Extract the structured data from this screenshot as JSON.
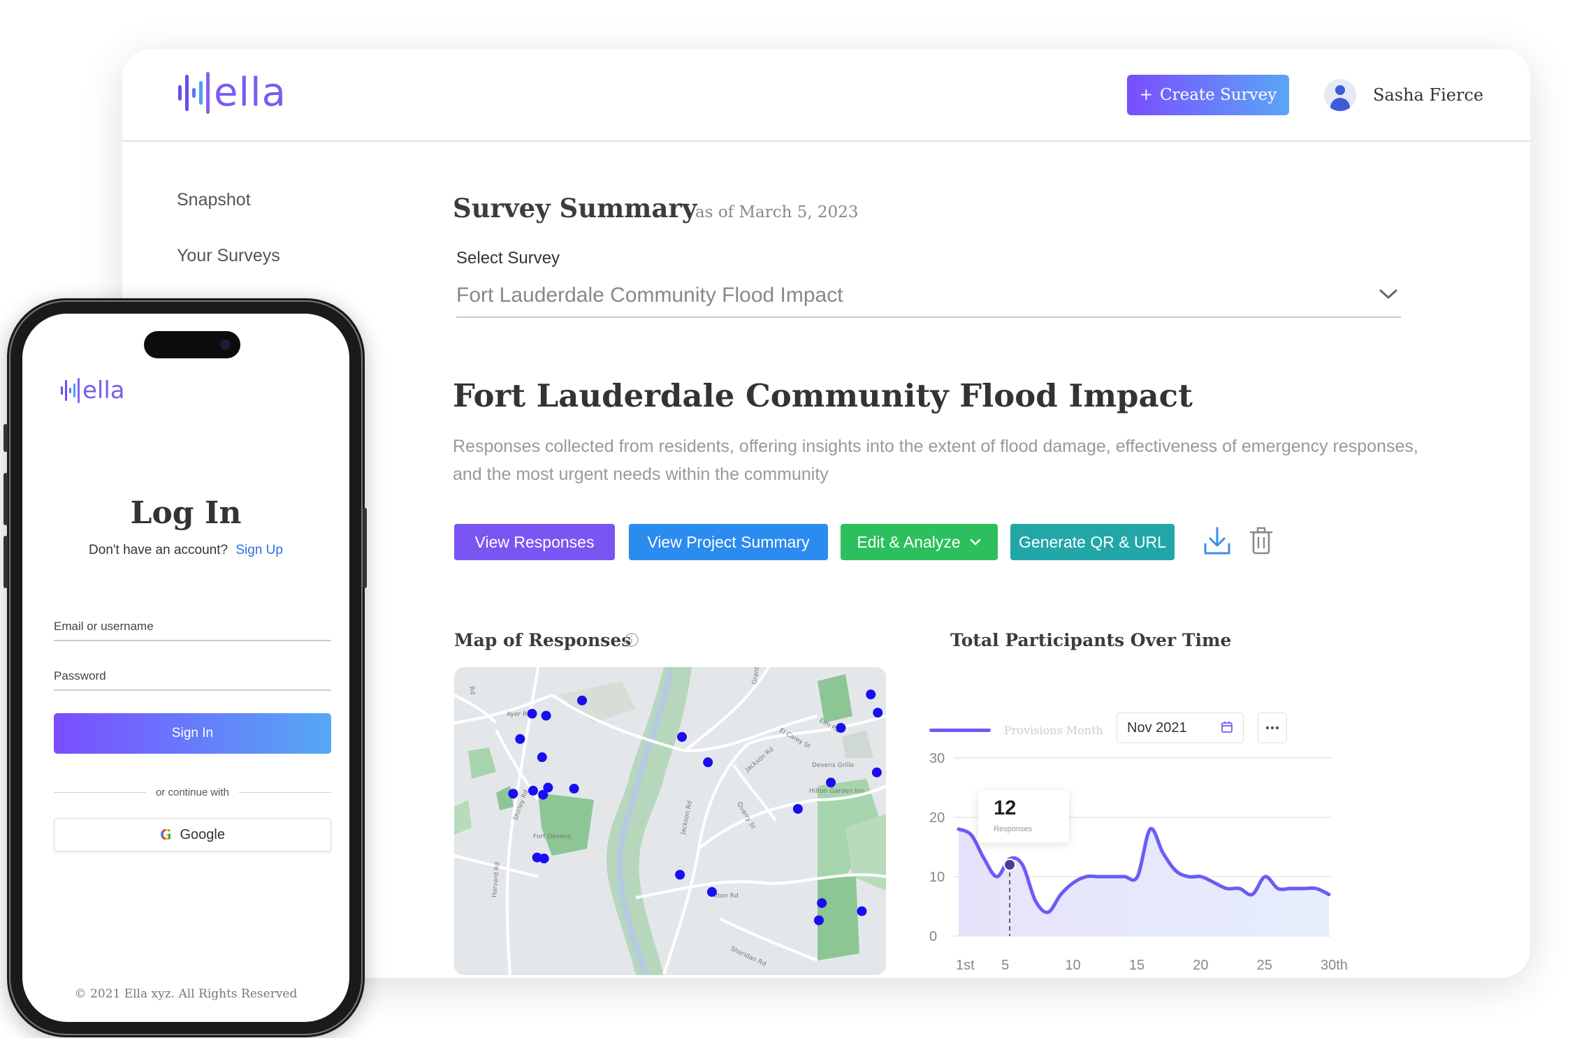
{
  "brand": {
    "logo_text": "ella"
  },
  "header": {
    "create_button_icon": "+",
    "create_button_label": "Create Survey",
    "user_name": "Sasha Fierce"
  },
  "sidebar": {
    "items": [
      {
        "label": "Snapshot"
      },
      {
        "label": "Your Surveys"
      }
    ]
  },
  "summary": {
    "title": "Survey Summary",
    "as_of": "as of March 5, 2023",
    "select_label": "Select Survey",
    "select_value": "Fort Lauderdale Community Flood Impact"
  },
  "project": {
    "title": "Fort Lauderdale Community Flood Impact",
    "description": "Responses collected from residents, offering insights into the extent of flood damage, effectiveness of emergency responses, and the most urgent needs within the community"
  },
  "actions": {
    "view_responses": "View Responses",
    "view_project_summary": "View Project Summary",
    "edit_analyze": "Edit & Analyze",
    "generate_qr": "Generate QR & URL",
    "download_icon": "download-icon",
    "delete_icon": "trash-icon"
  },
  "map": {
    "title": "Map of Responses",
    "info_icon": "info-icon",
    "labels": {
      "ayer_rd": "Ayer Rd",
      "fort_devens": "Fort Devens",
      "harvard_rd": "Harvard Rd",
      "jackson_rd": "Jackson Rd",
      "devens_grille": "Devens Grille",
      "hilton_garden_inn": "Hilton Garden Inn",
      "elm_rd": "Elm Rd",
      "el_carey_st": "El Carey St",
      "jackson_rd_2": "Jackson Rd",
      "hilton_rd": "ilton Rd",
      "quarry_st": "Quarry St",
      "grant_rd": "Grant Rd",
      "shirley_rd": "Shirley Rd",
      "saratoga_rd": "Sheridan Rd",
      "rd_top_left": "Rd"
    },
    "dot_color": "#1a0ef0"
  },
  "chart": {
    "title": "Total Participants Over Time",
    "legend": "Provisions Month",
    "date_value": "Nov 2021",
    "calendar_icon": "calendar-icon",
    "more_icon": "more-icon",
    "tooltip_value": "12",
    "tooltip_label": "Responses",
    "y_ticks": [
      "30",
      "20",
      "10",
      "0"
    ],
    "x_ticks": [
      "1st",
      "5",
      "10",
      "15",
      "20",
      "25",
      "30th"
    ]
  },
  "chart_data": {
    "type": "area",
    "title": "Total Participants Over Time",
    "series": [
      {
        "name": "Provisions Month",
        "color": "#6b5cf5"
      }
    ],
    "x": [
      1,
      2,
      3,
      4,
      5,
      6,
      7,
      8,
      9,
      10,
      11,
      12,
      13,
      14,
      15,
      16,
      17,
      18,
      19,
      20,
      21,
      22,
      23,
      24,
      25,
      26,
      27,
      28,
      29,
      30
    ],
    "values": [
      18,
      17,
      13,
      10,
      13,
      12,
      6,
      4,
      7,
      9,
      10,
      10,
      10,
      10,
      10,
      18,
      14,
      11,
      10,
      10,
      9,
      8,
      8,
      7,
      10,
      8,
      8,
      8,
      8,
      7
    ],
    "ylim": [
      0,
      30
    ],
    "highlight": {
      "x": 5,
      "value": 12,
      "label": "Responses"
    },
    "grid": true
  },
  "phone": {
    "logo_text": "ella",
    "title": "Log In",
    "no_account": "Don't have an account?",
    "signup_link": "Sign Up",
    "email_label": "Email or username",
    "password_label": "Password",
    "signin_label": "Sign In",
    "or_text": "or continue with",
    "google_label": "Google",
    "google_icon": "G",
    "footer": "© 2021 Ella xyz. All Rights Reserved"
  },
  "colors": {
    "primary": "#7a4dff",
    "view_responses": "#7a55f2",
    "view_project": "#2b8bee",
    "edit_analyze": "#2cbf5d",
    "generate_qr": "#22a6a8",
    "line": "#6b5cf5"
  }
}
